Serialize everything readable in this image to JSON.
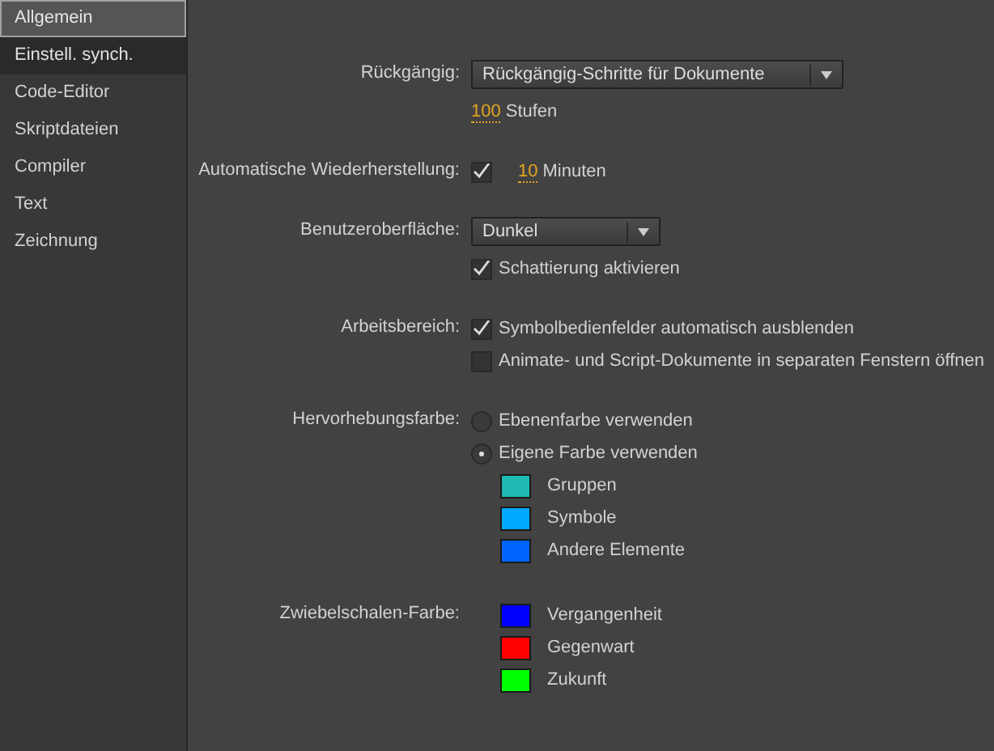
{
  "sidebar": {
    "items": [
      {
        "label": "Allgemein",
        "selected": true,
        "hovered": false
      },
      {
        "label": "Einstell. synch.",
        "selected": false,
        "hovered": true
      },
      {
        "label": "Code-Editor",
        "selected": false,
        "hovered": false
      },
      {
        "label": "Skriptdateien",
        "selected": false,
        "hovered": false
      },
      {
        "label": "Compiler",
        "selected": false,
        "hovered": false
      },
      {
        "label": "Text",
        "selected": false,
        "hovered": false
      },
      {
        "label": "Zeichnung",
        "selected": false,
        "hovered": false
      }
    ]
  },
  "sections": [
    {
      "label": "Rückgängig:",
      "rows": [
        {
          "kind": "dropdown",
          "value": "Rückgängig-Schritte für Dokumente"
        },
        {
          "kind": "number",
          "value": "100",
          "unit": "Stufen"
        }
      ]
    },
    {
      "label": "Automatische Wiederherstellung:",
      "rows": [
        {
          "kind": "checknumber",
          "checked": true,
          "value": "10",
          "unit": "Minuten"
        }
      ]
    },
    {
      "label": "Benutzeroberfläche:",
      "rows": [
        {
          "kind": "dropdown",
          "value": "Dunkel"
        },
        {
          "kind": "checkbox",
          "checked": true,
          "label": "Schattierung aktivieren"
        }
      ]
    },
    {
      "label": "Arbeitsbereich:",
      "rows": [
        {
          "kind": "checkbox",
          "checked": true,
          "label": "Symbolbedienfelder automatisch ausblenden"
        },
        {
          "kind": "checkbox",
          "checked": false,
          "label": "Animate- und Script-Dokumente in separaten Fenstern öffnen"
        }
      ]
    },
    {
      "label": "Hervorhebungsfarbe:",
      "rows": [
        {
          "kind": "radio",
          "selected": false,
          "label": "Ebenenfarbe verwenden"
        },
        {
          "kind": "radio",
          "selected": true,
          "label": "Eigene Farbe verwenden"
        },
        {
          "kind": "swatch",
          "color": "#1fbab2",
          "label": "Gruppen"
        },
        {
          "kind": "swatch",
          "color": "#00a8ff",
          "label": "Symbole"
        },
        {
          "kind": "swatch",
          "color": "#0064ff",
          "label": "Andere Elemente"
        }
      ]
    },
    {
      "label": "Zwiebelschalen-Farbe:",
      "rows": [
        {
          "kind": "swatch",
          "color": "#0000ff",
          "label": "Vergangenheit"
        },
        {
          "kind": "swatch",
          "color": "#ff0000",
          "label": "Gegenwart"
        },
        {
          "kind": "swatch",
          "color": "#00ff00",
          "label": "Zukunft"
        }
      ]
    }
  ]
}
